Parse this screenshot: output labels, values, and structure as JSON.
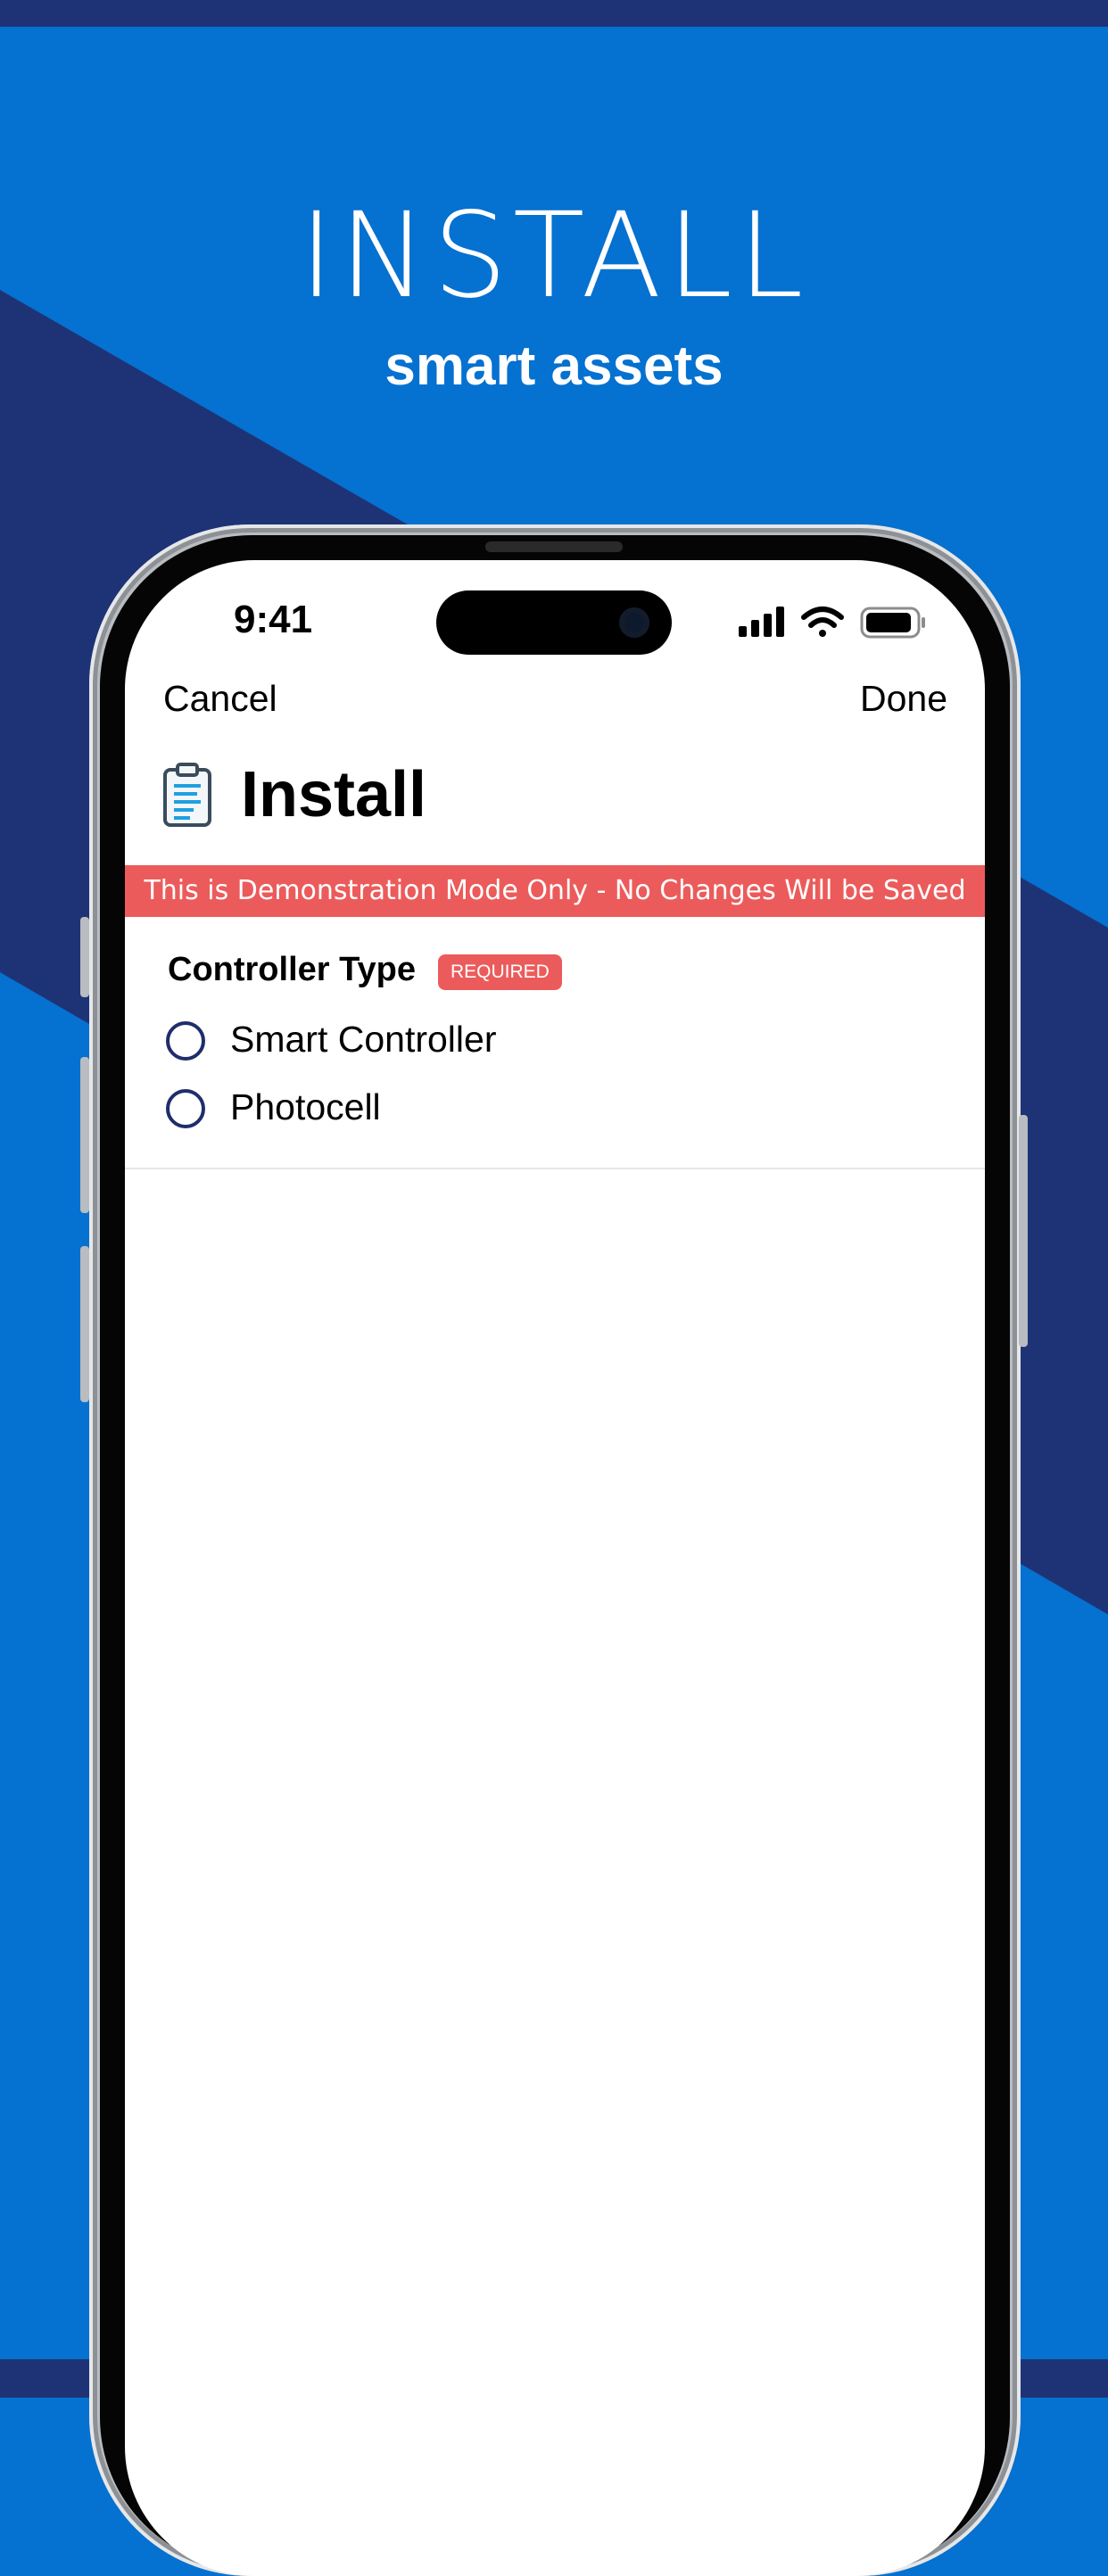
{
  "promo": {
    "headline": "INSTALL",
    "subheadline": "smart assets"
  },
  "colors": {
    "background_blue": "#0571d0",
    "background_navy": "#1e3376",
    "banner_red": "#ec5b5b",
    "radio_border": "#1f2d6b"
  },
  "status_bar": {
    "time": "9:41",
    "icons": [
      "signal-icon",
      "wifi-icon",
      "battery-icon"
    ]
  },
  "nav": {
    "cancel_label": "Cancel",
    "done_label": "Done"
  },
  "page": {
    "title": "Install",
    "title_icon": "clipboard-icon"
  },
  "banner": {
    "text": "This is Demonstration Mode Only - No Changes Will be Saved"
  },
  "form": {
    "controller_type": {
      "label": "Controller Type",
      "badge": "REQUIRED",
      "options": [
        {
          "label": "Smart Controller",
          "selected": false
        },
        {
          "label": "Photocell",
          "selected": false
        }
      ]
    }
  }
}
